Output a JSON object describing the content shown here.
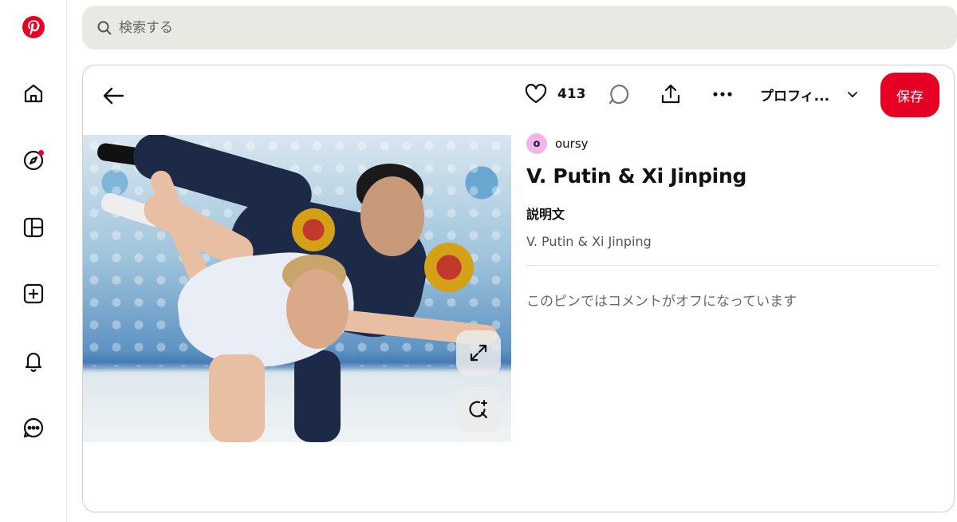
{
  "search": {
    "placeholder": "検索する"
  },
  "sidebar": {
    "items": [
      {
        "name": "logo",
        "icon": "pinterest-logo-icon"
      },
      {
        "name": "home",
        "icon": "home-icon"
      },
      {
        "name": "explore",
        "icon": "compass-icon",
        "badge": true
      },
      {
        "name": "boards",
        "icon": "board-grid-icon"
      },
      {
        "name": "create",
        "icon": "plus-square-icon"
      },
      {
        "name": "notifications",
        "icon": "bell-icon"
      },
      {
        "name": "messages",
        "icon": "chat-bubble-icon"
      }
    ]
  },
  "toolbar": {
    "like_count": "413",
    "profile_label": "プロフィ...",
    "save_label": "保存"
  },
  "pin": {
    "author_initial": "o",
    "author_name": "oursy",
    "title": "V. Putin & Xi Jinping",
    "description_heading": "説明文",
    "description": "V. Putin & Xi Jinping",
    "comments_off": "このピンではコメントがオフになっています"
  },
  "colors": {
    "brand": "#e60023",
    "search_bg": "#e9e9e4",
    "avatar_bg": "#f0b6e8"
  }
}
